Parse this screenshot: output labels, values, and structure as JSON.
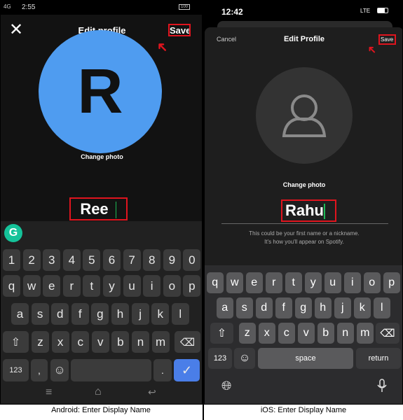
{
  "android": {
    "status": {
      "time": "2:55",
      "signal": "4G",
      "battery": "100"
    },
    "header": {
      "close_icon": "close-icon",
      "title": "Edit profile",
      "save": "Save"
    },
    "avatar": {
      "letter": "R",
      "color": "#4f9cf0"
    },
    "change_photo": "Change photo",
    "name_value": "Ree",
    "keyboard": {
      "rows": [
        [
          "1",
          "2",
          "3",
          "4",
          "5",
          "6",
          "7",
          "8",
          "9",
          "0"
        ],
        [
          "q",
          "w",
          "e",
          "r",
          "t",
          "y",
          "u",
          "i",
          "o",
          "p"
        ],
        [
          "a",
          "s",
          "d",
          "f",
          "g",
          "h",
          "j",
          "k",
          "l"
        ],
        [
          "z",
          "x",
          "c",
          "v",
          "b",
          "n",
          "m"
        ]
      ],
      "numbers_key": "123",
      "comma": ",",
      "period": ".",
      "accent": "#4a7ee8"
    },
    "caption": "Android: Enter Display Name"
  },
  "ios": {
    "status": {
      "time": "12:42",
      "network": "LTE"
    },
    "header": {
      "cancel": "Cancel",
      "title": "Edit Profile",
      "save": "Save"
    },
    "change_photo": "Change photo",
    "name_value": "Rahu",
    "hint_line1": "This could be your first name or a nickname.",
    "hint_line2": "It's how you'll appear on Spotify.",
    "keyboard": {
      "rows": [
        [
          "q",
          "w",
          "e",
          "r",
          "t",
          "y",
          "u",
          "i",
          "o",
          "p"
        ],
        [
          "a",
          "s",
          "d",
          "f",
          "g",
          "h",
          "j",
          "k",
          "l"
        ],
        [
          "z",
          "x",
          "c",
          "v",
          "b",
          "n",
          "m"
        ]
      ],
      "numbers_key": "123",
      "space": "space",
      "return": "return"
    },
    "caption": "iOS: Enter Display Name"
  },
  "highlight_color": "#e0141e"
}
